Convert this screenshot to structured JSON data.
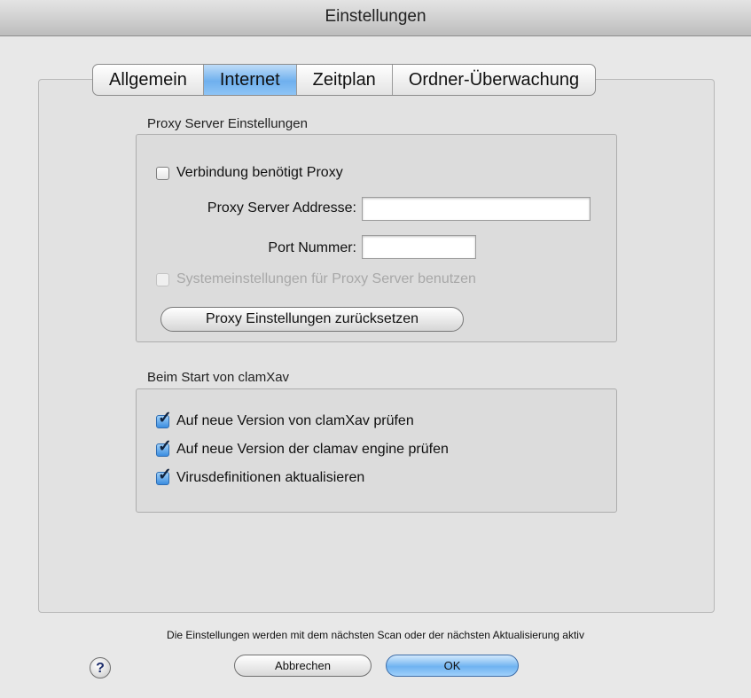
{
  "window": {
    "title": "Einstellungen"
  },
  "tabs": [
    {
      "label": "Allgemein",
      "active": false
    },
    {
      "label": "Internet",
      "active": true
    },
    {
      "label": "Zeitplan",
      "active": false
    },
    {
      "label": "Ordner-Überwachung",
      "active": false
    }
  ],
  "proxy": {
    "group_label": "Proxy Server Einstellungen",
    "requires_proxy_label": "Verbindung benötigt Proxy",
    "requires_proxy_checked": false,
    "address_label": "Proxy Server Addresse:",
    "address_value": "",
    "port_label": "Port Nummer:",
    "port_value": "",
    "system_settings_label": "Systemeinstellungen für Proxy Server benutzen",
    "system_settings_checked": false,
    "system_settings_enabled": false,
    "reset_button_label": "Proxy Einstellungen zurücksetzen"
  },
  "startup": {
    "group_label": "Beim Start von clamXav",
    "options": [
      {
        "label": "Auf neue Version von clamXav prüfen",
        "checked": true
      },
      {
        "label": "Auf neue Version der clamav engine prüfen",
        "checked": true
      },
      {
        "label": "Virusdefinitionen aktualisieren",
        "checked": true
      }
    ]
  },
  "footer": {
    "note": "Die Einstellungen werden mit dem nächsten Scan oder der nächsten Aktualisierung aktiv",
    "help_label": "?",
    "cancel_label": "Abbrechen",
    "ok_label": "OK"
  },
  "colors": {
    "accent": "#6fb0ee",
    "window_bg": "#e8e8e8"
  },
  "icons": {
    "checkmark": "checkmark-icon",
    "help": "question-mark-icon"
  }
}
